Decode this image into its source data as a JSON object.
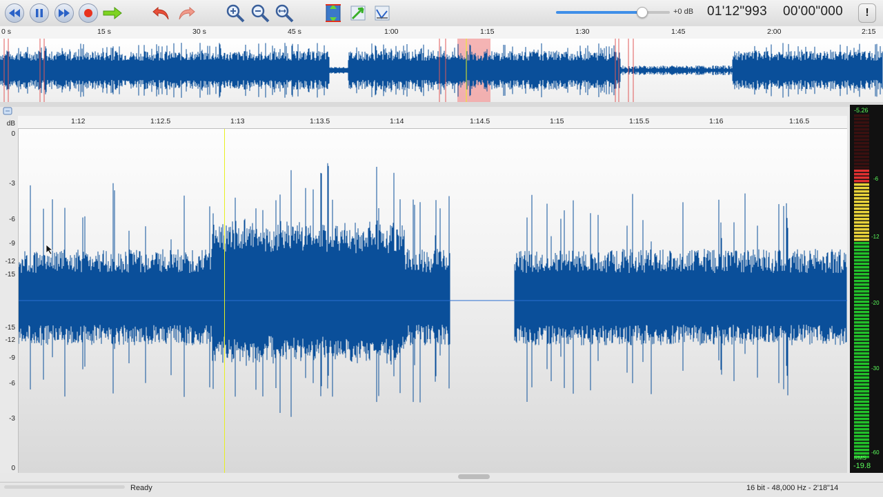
{
  "toolbar": {
    "buttons": [
      {
        "name": "rewind-button",
        "icon": "rewind-icon"
      },
      {
        "name": "pause-button",
        "icon": "pause-icon"
      },
      {
        "name": "fast-forward-button",
        "icon": "fast-forward-icon"
      },
      {
        "name": "record-button",
        "icon": "record-icon"
      },
      {
        "name": "play-selection-button",
        "icon": "arrow-right-icon"
      },
      {
        "name": "undo-button",
        "icon": "undo-icon"
      },
      {
        "name": "redo-button",
        "icon": "redo-icon"
      },
      {
        "name": "zoom-in-button",
        "icon": "zoom-in-icon"
      },
      {
        "name": "zoom-out-button",
        "icon": "zoom-out-icon"
      },
      {
        "name": "zoom-fit-button",
        "icon": "zoom-fit-icon"
      },
      {
        "name": "vertical-zoom-button",
        "icon": "vertical-zoom-icon"
      },
      {
        "name": "normalize-button",
        "icon": "normalize-icon"
      },
      {
        "name": "analyze-button",
        "icon": "analyze-icon"
      }
    ],
    "volume_level": 0.75,
    "volume_db": "+0 dB",
    "position_time": "01'12\"993",
    "selection_time": "00'00\"000",
    "info_label": "!"
  },
  "overview": {
    "ticks": [
      "0 s",
      "15 s",
      "30 s",
      "45 s",
      "1:00",
      "1:15",
      "1:30",
      "1:45",
      "2:00",
      "2:15"
    ]
  },
  "ruler": {
    "ticks": [
      "1:12",
      "1:12.5",
      "1:13",
      "1:13.5",
      "1:14",
      "1:14.5",
      "1:15",
      "1:15.5",
      "1:16",
      "1:16.5"
    ]
  },
  "db_scale": {
    "unit": "dB",
    "labels": [
      "0",
      "-3",
      "-6",
      "-9",
      "-12",
      "-15",
      "-15",
      "-12",
      "-9",
      "-6",
      "-3",
      "0"
    ]
  },
  "meter": {
    "peak": "-5.26",
    "labels": [
      "-6",
      "-12",
      "-20",
      "-30",
      "-60"
    ],
    "rms_label": "RMS",
    "rms_value": "-19.8"
  },
  "status": {
    "text": "Ready",
    "format": "16 bit - 48,000 Hz - 2'18\"14"
  },
  "colors": {
    "waveform": "#0a4f9a",
    "playhead": "#e8f020",
    "selection": "#f19b9b",
    "meter_green": "#22c02a",
    "meter_yellow": "#e8d23a",
    "meter_red": "#e03030"
  }
}
